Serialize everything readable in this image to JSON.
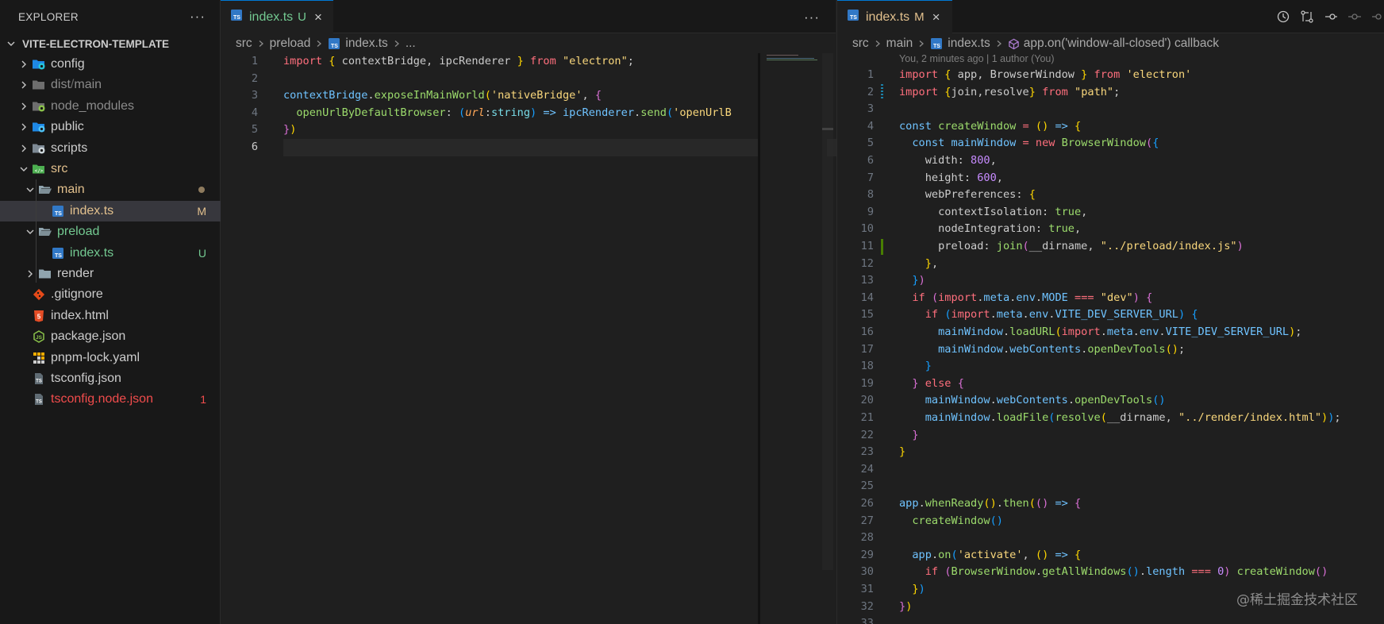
{
  "sidebar": {
    "title": "EXPLORER",
    "more_label": "···",
    "project": "VITE-ELECTRON-TEMPLATE",
    "items": [
      {
        "label": "config",
        "color": "#cccccc",
        "icon": "folder-config-icon",
        "chevron": "right",
        "badge": ""
      },
      {
        "label": "dist",
        "label2": "main",
        "color": "#8b8b8b",
        "icon": "folder-dist-icon",
        "chevron": "right",
        "badge": ""
      },
      {
        "label": "node_modules",
        "color": "#8b8b8b",
        "icon": "folder-node-icon",
        "chevron": "right",
        "badge": ""
      },
      {
        "label": "public",
        "color": "#cccccc",
        "icon": "folder-public-icon",
        "chevron": "right",
        "badge": ""
      },
      {
        "label": "scripts",
        "color": "#cccccc",
        "icon": "folder-scripts-icon",
        "chevron": "right",
        "badge": ""
      },
      {
        "label": "src",
        "color": "#e2c08d",
        "icon": "folder-src-icon",
        "chevron": "down",
        "badge": ""
      },
      {
        "label": "main",
        "color": "#e2c08d",
        "icon": "folder-open-icon",
        "chevron": "down",
        "badge": ""
      },
      {
        "label": "index.ts",
        "color": "#e2c08d",
        "icon": "typescript-file-icon",
        "chevron": "",
        "badge": "M"
      },
      {
        "label": "preload",
        "color": "#73c991",
        "icon": "folder-open-icon",
        "chevron": "down",
        "badge": ""
      },
      {
        "label": "index.ts",
        "color": "#73c991",
        "icon": "typescript-file-icon",
        "chevron": "",
        "badge": "U"
      },
      {
        "label": "render",
        "color": "#cccccc",
        "icon": "folder-icon",
        "chevron": "right",
        "badge": ""
      },
      {
        "label": ".gitignore",
        "color": "#cccccc",
        "icon": "git-icon",
        "chevron": "",
        "badge": ""
      },
      {
        "label": "index.html",
        "color": "#cccccc",
        "icon": "html-file-icon",
        "chevron": "",
        "badge": ""
      },
      {
        "label": "package.json",
        "color": "#cccccc",
        "icon": "node-json-icon",
        "chevron": "",
        "badge": ""
      },
      {
        "label": "pnpm-lock.yaml",
        "color": "#cccccc",
        "icon": "pnpm-icon",
        "chevron": "",
        "badge": ""
      },
      {
        "label": "tsconfig.json",
        "color": "#cccccc",
        "icon": "tsconfig-icon",
        "chevron": "",
        "badge": ""
      },
      {
        "label": "tsconfig.node.json",
        "color": "#f14c4c",
        "icon": "tsconfig-icon",
        "chevron": "",
        "badge": "1"
      }
    ]
  },
  "editor_left": {
    "tab": {
      "label": "index.ts",
      "status": "U",
      "close": "×"
    },
    "more_label": "···",
    "breadcrumb": [
      "src",
      "preload",
      "index.ts",
      "..."
    ],
    "active_line": "6",
    "line_numbers": [
      "1",
      "2",
      "3",
      "4",
      "5",
      "6"
    ],
    "lines": [
      [
        [
          "kw",
          "import"
        ],
        [
          "pl",
          " "
        ],
        [
          "br1",
          "{"
        ],
        [
          "pl",
          " contextBridge, ipcRenderer "
        ],
        [
          "br1",
          "}"
        ],
        [
          "pl",
          " "
        ],
        [
          "kw",
          "from"
        ],
        [
          "pl",
          " "
        ],
        [
          "str",
          "\"electron\""
        ],
        [
          "pl",
          ";"
        ]
      ],
      [],
      [
        [
          "var",
          "contextBridge"
        ],
        [
          "pl",
          "."
        ],
        [
          "fn",
          "exposeInMainWorld"
        ],
        [
          "br1",
          "("
        ],
        [
          "str",
          "'nativeBridge'"
        ],
        [
          "pl",
          ", "
        ],
        [
          "br2",
          "{"
        ]
      ],
      [
        [
          "pl",
          "  "
        ],
        [
          "fn",
          "openUrlByDefaultBrowser"
        ],
        [
          "pl",
          ": "
        ],
        [
          "br3",
          "("
        ],
        [
          "param",
          "url"
        ],
        [
          "pl",
          ":"
        ],
        [
          "typ",
          "string"
        ],
        [
          "br3",
          ")"
        ],
        [
          "pl",
          " "
        ],
        [
          "var",
          "=>"
        ],
        [
          "pl",
          " "
        ],
        [
          "var",
          "ipcRenderer"
        ],
        [
          "pl",
          "."
        ],
        [
          "fn",
          "send"
        ],
        [
          "br3",
          "("
        ],
        [
          "str",
          "'openUrlB"
        ]
      ],
      [
        [
          "br2",
          "}"
        ],
        [
          "br1",
          ")"
        ]
      ],
      []
    ]
  },
  "editor_right": {
    "tab": {
      "label": "index.ts",
      "status": "M",
      "close": "×"
    },
    "breadcrumb": [
      "src",
      "main",
      "index.ts",
      "app.on('window-all-closed') callback"
    ],
    "blame": "You, 2 minutes ago | 1 author (You)",
    "watermark": "@稀土掘金技术社区",
    "line_numbers": [
      "1",
      "2",
      "3",
      "4",
      "5",
      "6",
      "7",
      "8",
      "9",
      "10",
      "11",
      "12",
      "13",
      "14",
      "15",
      "16",
      "17",
      "18",
      "19",
      "20",
      "21",
      "22",
      "23",
      "24",
      "25",
      "26",
      "27",
      "28",
      "29",
      "30",
      "31",
      "32",
      "33"
    ],
    "lines": [
      [
        [
          "kw",
          "import"
        ],
        [
          "pl",
          " "
        ],
        [
          "br1",
          "{"
        ],
        [
          "pl",
          " app, BrowserWindow "
        ],
        [
          "br1",
          "}"
        ],
        [
          "pl",
          " "
        ],
        [
          "kw",
          "from"
        ],
        [
          "pl",
          " "
        ],
        [
          "str",
          "'electron'"
        ]
      ],
      [
        [
          "kw",
          "import"
        ],
        [
          "pl",
          " "
        ],
        [
          "br1",
          "{"
        ],
        [
          "pl",
          "join,resolve"
        ],
        [
          "br1",
          "}"
        ],
        [
          "pl",
          " "
        ],
        [
          "kw",
          "from"
        ],
        [
          "pl",
          " "
        ],
        [
          "str",
          "\"path\""
        ],
        [
          "pl",
          ";"
        ]
      ],
      [],
      [
        [
          "var",
          "const"
        ],
        [
          "pl",
          " "
        ],
        [
          "fn",
          "createWindow"
        ],
        [
          "pl",
          " "
        ],
        [
          "kw",
          "="
        ],
        [
          "pl",
          " "
        ],
        [
          "br1",
          "()"
        ],
        [
          "pl",
          " "
        ],
        [
          "var",
          "=>"
        ],
        [
          "pl",
          " "
        ],
        [
          "br1",
          "{"
        ]
      ],
      [
        [
          "pl",
          "  "
        ],
        [
          "var",
          "const"
        ],
        [
          "pl",
          " "
        ],
        [
          "var",
          "mainWindow"
        ],
        [
          "pl",
          " "
        ],
        [
          "kw",
          "="
        ],
        [
          "pl",
          " "
        ],
        [
          "kw",
          "new"
        ],
        [
          "pl",
          " "
        ],
        [
          "fn",
          "BrowserWindow"
        ],
        [
          "br2",
          "("
        ],
        [
          "br3",
          "{"
        ]
      ],
      [
        [
          "pl",
          "    width: "
        ],
        [
          "num",
          "800"
        ],
        [
          "pl",
          ","
        ]
      ],
      [
        [
          "pl",
          "    height: "
        ],
        [
          "num",
          "600"
        ],
        [
          "pl",
          ","
        ]
      ],
      [
        [
          "pl",
          "    webPreferences: "
        ],
        [
          "br1",
          "{"
        ]
      ],
      [
        [
          "pl",
          "      contextIsolation: "
        ],
        [
          "fn",
          "true"
        ],
        [
          "pl",
          ","
        ]
      ],
      [
        [
          "pl",
          "      nodeIntegration: "
        ],
        [
          "fn",
          "true"
        ],
        [
          "pl",
          ","
        ]
      ],
      [
        [
          "pl",
          "      preload: "
        ],
        [
          "fn",
          "join"
        ],
        [
          "br2",
          "("
        ],
        [
          "pl",
          "__dirname, "
        ],
        [
          "str",
          "\"../preload/index.js\""
        ],
        [
          "br2",
          ")"
        ]
      ],
      [
        [
          "pl",
          "    "
        ],
        [
          "br1",
          "}"
        ],
        [
          "pl",
          ","
        ]
      ],
      [
        [
          "pl",
          "  "
        ],
        [
          "br3",
          "}"
        ],
        [
          "br2",
          ")"
        ]
      ],
      [
        [
          "pl",
          "  "
        ],
        [
          "kw",
          "if"
        ],
        [
          "pl",
          " "
        ],
        [
          "br2",
          "("
        ],
        [
          "kw",
          "import"
        ],
        [
          "pl",
          "."
        ],
        [
          "var",
          "meta"
        ],
        [
          "pl",
          "."
        ],
        [
          "var",
          "env"
        ],
        [
          "pl",
          "."
        ],
        [
          "var",
          "MODE"
        ],
        [
          "pl",
          " "
        ],
        [
          "kw",
          "==="
        ],
        [
          "pl",
          " "
        ],
        [
          "str",
          "\"dev\""
        ],
        [
          "br2",
          ")"
        ],
        [
          "pl",
          " "
        ],
        [
          "br2",
          "{"
        ]
      ],
      [
        [
          "pl",
          "    "
        ],
        [
          "kw",
          "if"
        ],
        [
          "pl",
          " "
        ],
        [
          "br3",
          "("
        ],
        [
          "kw",
          "import"
        ],
        [
          "pl",
          "."
        ],
        [
          "var",
          "meta"
        ],
        [
          "pl",
          "."
        ],
        [
          "var",
          "env"
        ],
        [
          "pl",
          "."
        ],
        [
          "var",
          "VITE_DEV_SERVER_URL"
        ],
        [
          "br3",
          ")"
        ],
        [
          "pl",
          " "
        ],
        [
          "br3",
          "{"
        ]
      ],
      [
        [
          "pl",
          "      "
        ],
        [
          "var",
          "mainWindow"
        ],
        [
          "pl",
          "."
        ],
        [
          "fn",
          "loadURL"
        ],
        [
          "br1",
          "("
        ],
        [
          "kw",
          "import"
        ],
        [
          "pl",
          "."
        ],
        [
          "var",
          "meta"
        ],
        [
          "pl",
          "."
        ],
        [
          "var",
          "env"
        ],
        [
          "pl",
          "."
        ],
        [
          "var",
          "VITE_DEV_SERVER_URL"
        ],
        [
          "br1",
          ")"
        ],
        [
          "pl",
          ";"
        ]
      ],
      [
        [
          "pl",
          "      "
        ],
        [
          "var",
          "mainWindow"
        ],
        [
          "pl",
          "."
        ],
        [
          "var",
          "webContents"
        ],
        [
          "pl",
          "."
        ],
        [
          "fn",
          "openDevTools"
        ],
        [
          "br1",
          "()"
        ],
        [
          "pl",
          ";"
        ]
      ],
      [
        [
          "pl",
          "    "
        ],
        [
          "br3",
          "}"
        ]
      ],
      [
        [
          "pl",
          "  "
        ],
        [
          "br2",
          "}"
        ],
        [
          "pl",
          " "
        ],
        [
          "kw",
          "else"
        ],
        [
          "pl",
          " "
        ],
        [
          "br2",
          "{"
        ]
      ],
      [
        [
          "pl",
          "    "
        ],
        [
          "var",
          "mainWindow"
        ],
        [
          "pl",
          "."
        ],
        [
          "var",
          "webContents"
        ],
        [
          "pl",
          "."
        ],
        [
          "fn",
          "openDevTools"
        ],
        [
          "br3",
          "()"
        ]
      ],
      [
        [
          "pl",
          "    "
        ],
        [
          "var",
          "mainWindow"
        ],
        [
          "pl",
          "."
        ],
        [
          "fn",
          "loadFile"
        ],
        [
          "br3",
          "("
        ],
        [
          "fn",
          "resolve"
        ],
        [
          "br1",
          "("
        ],
        [
          "pl",
          "__dirname, "
        ],
        [
          "str",
          "\"../render/index.html\""
        ],
        [
          "br1",
          ")"
        ],
        [
          "br3",
          ")"
        ],
        [
          "pl",
          ";"
        ]
      ],
      [
        [
          "pl",
          "  "
        ],
        [
          "br2",
          "}"
        ]
      ],
      [
        [
          "br1",
          "}"
        ]
      ],
      [],
      [],
      [
        [
          "var",
          "app"
        ],
        [
          "pl",
          "."
        ],
        [
          "fn",
          "whenReady"
        ],
        [
          "br1",
          "()"
        ],
        [
          "pl",
          "."
        ],
        [
          "fn",
          "then"
        ],
        [
          "br1",
          "("
        ],
        [
          "br2",
          "()"
        ],
        [
          "pl",
          " "
        ],
        [
          "var",
          "=>"
        ],
        [
          "pl",
          " "
        ],
        [
          "br2",
          "{"
        ]
      ],
      [
        [
          "pl",
          "  "
        ],
        [
          "fn",
          "createWindow"
        ],
        [
          "br3",
          "()"
        ]
      ],
      [],
      [
        [
          "pl",
          "  "
        ],
        [
          "var",
          "app"
        ],
        [
          "pl",
          "."
        ],
        [
          "fn",
          "on"
        ],
        [
          "br3",
          "("
        ],
        [
          "str",
          "'activate'"
        ],
        [
          "pl",
          ", "
        ],
        [
          "br1",
          "()"
        ],
        [
          "pl",
          " "
        ],
        [
          "var",
          "=>"
        ],
        [
          "pl",
          " "
        ],
        [
          "br1",
          "{"
        ]
      ],
      [
        [
          "pl",
          "    "
        ],
        [
          "kw",
          "if"
        ],
        [
          "pl",
          " "
        ],
        [
          "br2",
          "("
        ],
        [
          "fn",
          "BrowserWindow"
        ],
        [
          "pl",
          "."
        ],
        [
          "fn",
          "getAllWindows"
        ],
        [
          "br3",
          "()"
        ],
        [
          "pl",
          "."
        ],
        [
          "var",
          "length"
        ],
        [
          "pl",
          " "
        ],
        [
          "kw",
          "==="
        ],
        [
          "pl",
          " "
        ],
        [
          "num",
          "0"
        ],
        [
          "br2",
          ")"
        ],
        [
          "pl",
          " "
        ],
        [
          "fn",
          "createWindow"
        ],
        [
          "br2",
          "()"
        ]
      ],
      [
        [
          "pl",
          "  "
        ],
        [
          "br1",
          "}"
        ],
        [
          "br3",
          ")"
        ]
      ],
      [
        [
          "br2",
          "}"
        ],
        [
          "br1",
          ")"
        ]
      ],
      []
    ]
  }
}
